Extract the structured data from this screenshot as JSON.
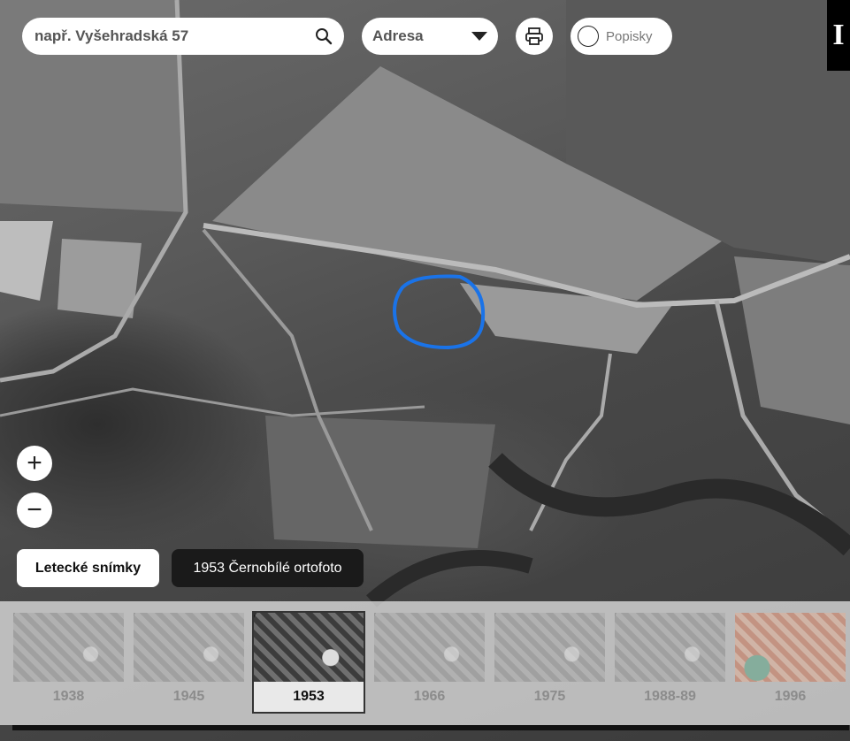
{
  "search": {
    "placeholder": "např. Vyšehradská 57"
  },
  "search_type": {
    "selected": "Adresa"
  },
  "labels_toggle": {
    "label": "Popisky"
  },
  "info": {
    "label": "I"
  },
  "zoom": {
    "in": "+",
    "out": "−"
  },
  "layer": {
    "button_label": "Letecké snímky",
    "current": "1953 Černobílé ortofoto"
  },
  "timeline": {
    "selected": "1953",
    "years": [
      {
        "label": "1938"
      },
      {
        "label": "1945"
      },
      {
        "label": "1953"
      },
      {
        "label": "1966"
      },
      {
        "label": "1975"
      },
      {
        "label": "1988-89"
      },
      {
        "label": "1996"
      }
    ]
  },
  "colors": {
    "marker": "#1a73e8"
  }
}
